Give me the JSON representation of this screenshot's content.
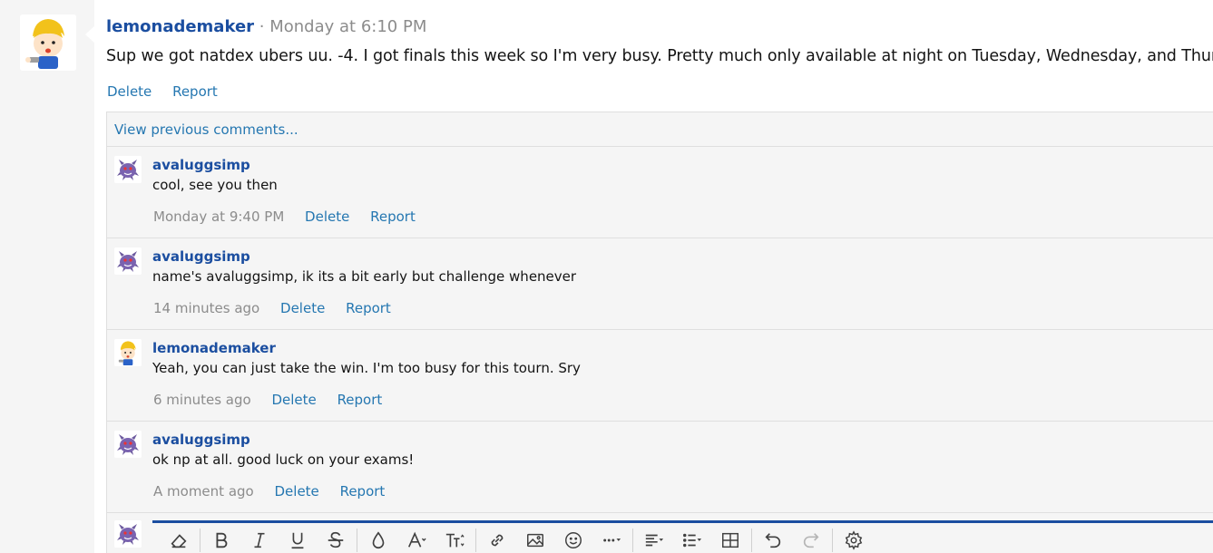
{
  "post": {
    "author": "lemonademaker",
    "separator": "·",
    "time": "Monday at 6:10 PM",
    "body": "Sup we got natdex ubers uu. -4. I got finals this week so I'm very busy. Pretty much only available at night on Tuesday, Wednesday, and Thursday.",
    "actions": {
      "delete": "Delete",
      "report": "Report"
    }
  },
  "comments_section": {
    "view_previous": "View previous comments...",
    "comments": [
      {
        "author": "avaluggsimp",
        "text": "cool, see you then",
        "time": "Monday at 9:40 PM",
        "delete": "Delete",
        "report": "Report"
      },
      {
        "author": "avaluggsimp",
        "text": "name's avaluggsimp, ik its a bit early but challenge whenever",
        "time": "14 minutes ago",
        "delete": "Delete",
        "report": "Report"
      },
      {
        "author": "lemonademaker",
        "text": "Yeah, you can just take the win. I'm too busy for this tourn. Sry",
        "time": "6 minutes ago",
        "delete": "Delete",
        "report": "Report"
      },
      {
        "author": "avaluggsimp",
        "text": "ok np at all. good luck on your exams!",
        "time": "A moment ago",
        "delete": "Delete",
        "report": "Report"
      }
    ]
  },
  "editor": {
    "toolbar": [
      "eraser-icon",
      "bold-icon",
      "italic-icon",
      "underline-icon",
      "strikethrough-icon",
      "text-color-icon",
      "font-size-icon",
      "font-family-icon",
      "link-icon",
      "image-icon",
      "smilie-icon",
      "more-icon",
      "align-icon",
      "list-icon",
      "table-icon",
      "undo-icon",
      "redo-icon",
      "settings-icon"
    ]
  },
  "colors": {
    "author": "#1b4ea0",
    "link": "#2577b1",
    "muted": "#8c8c8c",
    "accent": "#1b4ea0"
  }
}
